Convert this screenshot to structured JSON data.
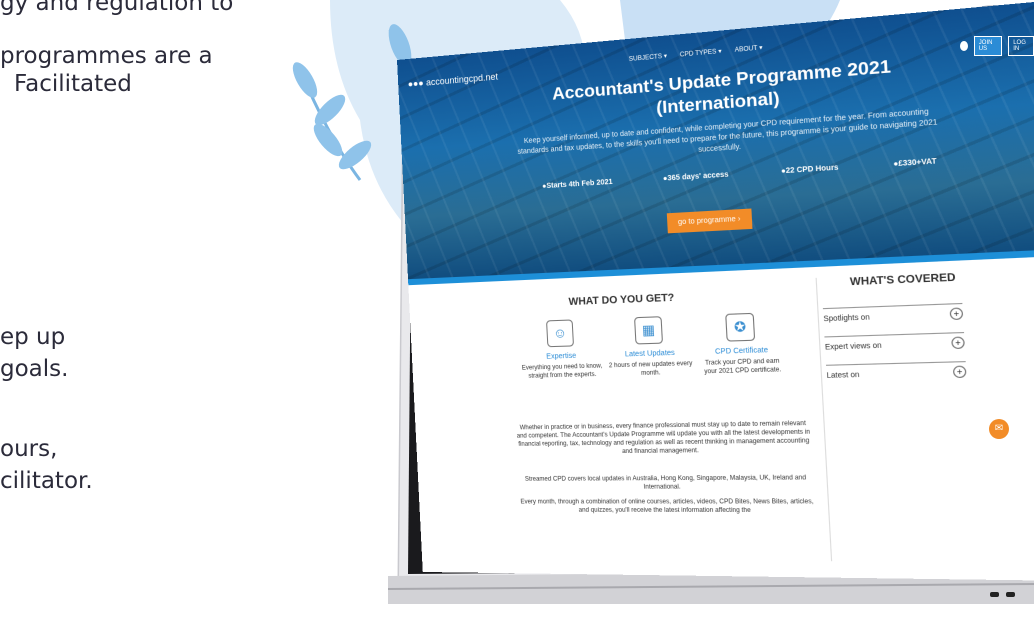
{
  "left_copy": {
    "line1": "gy and regulation to",
    "line2": "programmes are a",
    "line3": "Facilitated",
    "line4": "ep up",
    "line5": "goals.",
    "line6": "ours,",
    "line7": "cilitator."
  },
  "header": {
    "logo": "accountingcpd.net",
    "nav": [
      "SUBJECTS",
      "CPD TYPES",
      "ABOUT"
    ],
    "join_label": "JOIN US",
    "login_label": "LOG IN"
  },
  "hero": {
    "title": "Accountant's Update Programme 2021 (International)",
    "description": "Keep yourself informed, up to date and confident, while completing your CPD requirement for the year. From accounting standards and tax updates, to the skills you'll need to prepare for the future, this programme is your guide to navigating 2021 successfully.",
    "meta": [
      "Starts 4th Feb 2021",
      "365 days' access",
      "22 CPD Hours",
      "£330+VAT"
    ],
    "cta": "go to programme ›"
  },
  "what_do_you_get": {
    "title": "WHAT DO YOU GET?",
    "features": [
      {
        "title": "Expertise",
        "desc": "Everything you need to know, straight from the experts."
      },
      {
        "title": "Latest Updates",
        "desc": "2 hours of new updates every month."
      },
      {
        "title": "CPD Certificate",
        "desc": "Track your CPD and earn your 2021 CPD certificate."
      }
    ],
    "para1": "Whether in practice or in business, every finance professional must stay up to date to remain relevant and competent. The Accountant's Update Programme will update you with all the latest developments in financial reporting, tax, technology and regulation as well as recent thinking in management accounting and financial management.",
    "para2": "Streamed CPD covers local updates in Australia, Hong Kong, Singapore, Malaysia, UK, Ireland and International.",
    "para3": "Every month, through a combination of online courses, articles, videos, CPD Bites, News Bites, articles, and quizzes, you'll receive the latest information affecting the"
  },
  "whats_covered": {
    "title": "WHAT'S COVERED",
    "items": [
      "Spotlights on",
      "Expert views on",
      "Latest on"
    ]
  },
  "colors": {
    "accent": "#2b8cd6",
    "cta": "#f28c28",
    "hero_blue": "#1b6fae"
  }
}
